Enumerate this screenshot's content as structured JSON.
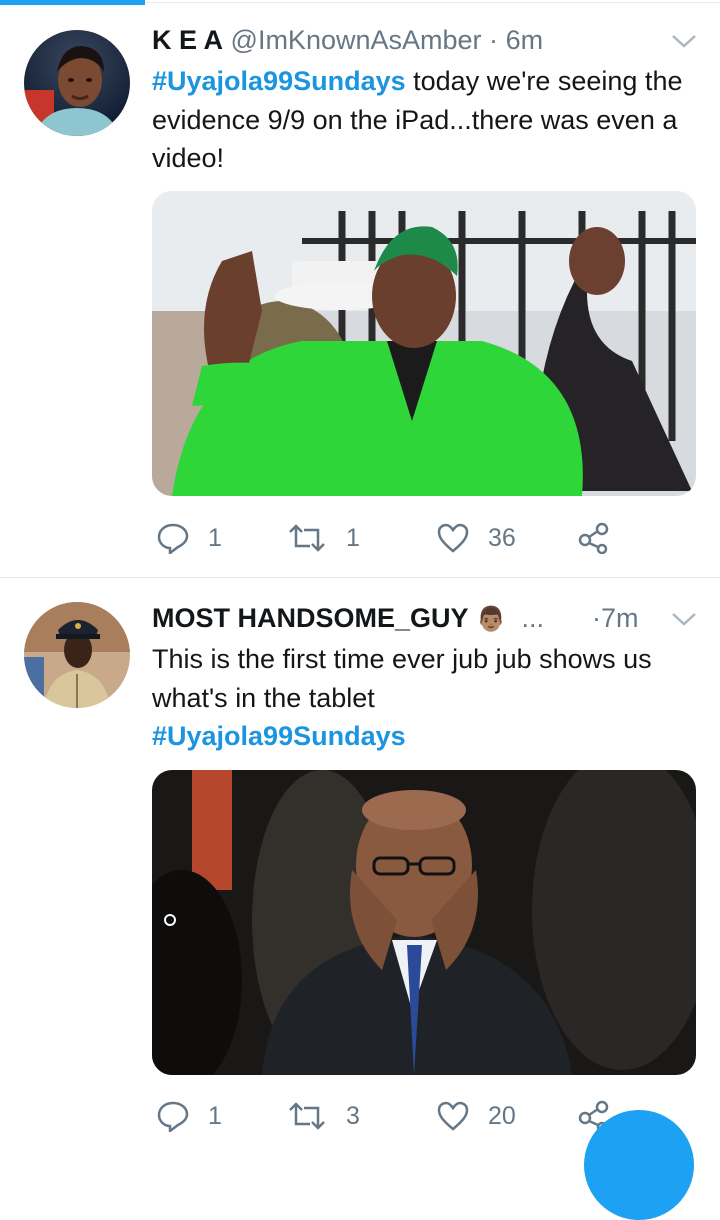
{
  "colors": {
    "accent": "#1da1f2",
    "hashtag": "#1b95e0",
    "secondary_text": "#657786",
    "primary_text": "#14171a"
  },
  "tweets": [
    {
      "name": "K E A",
      "handle": "@ImKnownAsAmber",
      "separator": "·",
      "time": "6m",
      "hashtag": "#Uyajola99Sundays",
      "text": " today we're seeing the evidence 9/9 on the iPad...there was even a video!",
      "media_description": "photo",
      "icons": {
        "reply": "reply-icon",
        "retweet": "retweet-icon",
        "like": "heart-icon",
        "share": "share-icon"
      },
      "reply_count": "1",
      "retweet_count": "1",
      "like_count": "36"
    },
    {
      "name": "MOST HANDSOME_GUY",
      "emoji": "👨🏽",
      "ellipsis": "...",
      "separator": "·",
      "time": "7m",
      "text": "This is the first time ever  jub jub shows us what's in the tablet",
      "hashtag": "#Uyajola99Sundays",
      "media_description": "photo",
      "icons": {
        "reply": "reply-icon",
        "retweet": "retweet-icon",
        "like": "heart-icon",
        "share": "share-icon"
      },
      "reply_count": "1",
      "retweet_count": "3",
      "like_count": "20"
    }
  ]
}
